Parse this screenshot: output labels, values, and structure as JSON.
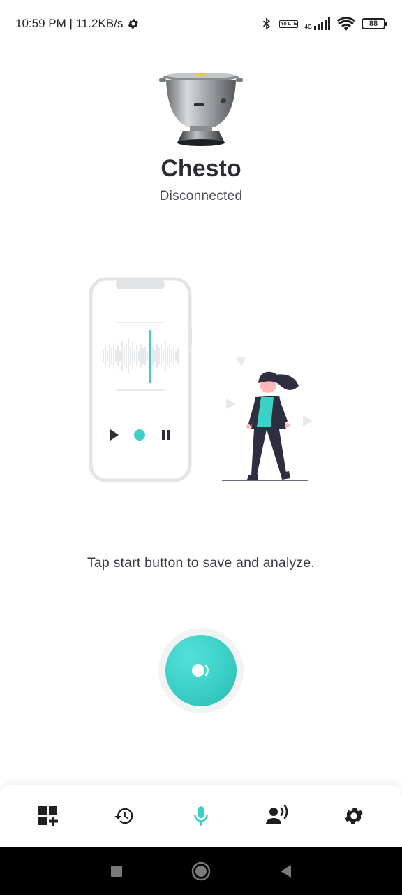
{
  "status_bar": {
    "time_speed": "10:59 PM | 11.2KB/s",
    "network_label": "4G",
    "volte_label": "Yo LTE",
    "battery_level": "88"
  },
  "device": {
    "name": "Chesto",
    "connection_status": "Disconnected"
  },
  "hint_text": "Tap start button to save and analyze.",
  "colors": {
    "accent": "#3cd1c7",
    "text_dark": "#2b2d33",
    "nav_active": "#3cd1c7"
  },
  "bottom_nav": {
    "items": [
      {
        "icon": "dashboard-add-icon",
        "active": false
      },
      {
        "icon": "history-icon",
        "active": false
      },
      {
        "icon": "microphone-icon",
        "active": true
      },
      {
        "icon": "voice-profile-icon",
        "active": false
      },
      {
        "icon": "gear-icon",
        "active": false
      }
    ]
  }
}
